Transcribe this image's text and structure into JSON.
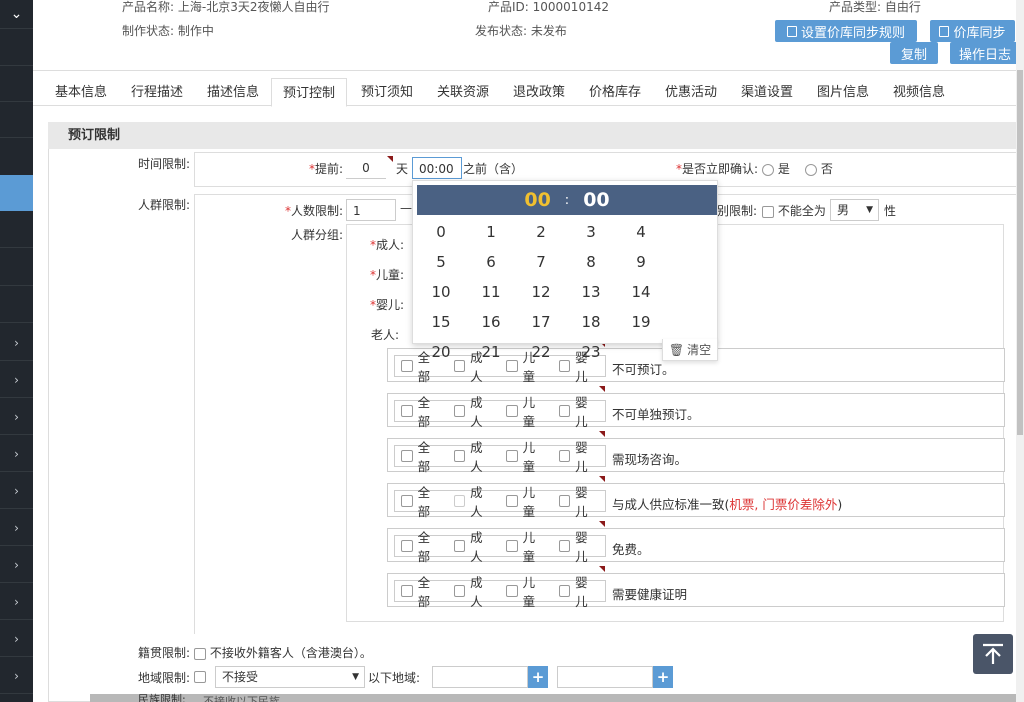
{
  "sidebar": {
    "toggle_icon": "chevron-down-icon",
    "item_icon": "chevron-right-icon"
  },
  "header": {
    "product_name": "产品名称: 上海-北京3天2夜懒人自由行",
    "product_id": "产品ID: 1000010142",
    "product_type": "产品类型: 自由行",
    "make_status": "制作状态: 制作中",
    "publish_status": "发布状态: 未发布",
    "btn_sync_rule": "设置价库同步规则",
    "btn_sync": "价库同步",
    "btn_copy": "复制",
    "btn_log": "操作日志"
  },
  "tabs": [
    "基本信息",
    "行程描述",
    "描述信息",
    "预订控制",
    "预订须知",
    "关联资源",
    "退改政策",
    "价格库存",
    "优惠活动",
    "渠道设置",
    "图片信息",
    "视频信息"
  ],
  "active_tab": "预订控制",
  "section": {
    "title": "预订限制"
  },
  "time_limit": {
    "label": "时间限制:",
    "advance_label": "提前:",
    "advance_days": "0",
    "day_unit": "天",
    "time_value": "00:00",
    "before_text": "之前（含）",
    "confirm_label": "是否立即确认:",
    "opt_yes": "是",
    "opt_no": "否"
  },
  "crowd": {
    "label": "人群限制:",
    "count_label": "人数限制:",
    "count_min": "1",
    "dash": "—",
    "gender_label_tail": "别限制:",
    "not_all": "不能全为",
    "gender_value": "男",
    "gender_tail": "性",
    "group_label": "人群分组:",
    "adult": "成人:",
    "child": "儿童:",
    "infant": "婴儿:",
    "elder": "老人:"
  },
  "rule_opts": [
    "全部",
    "成人",
    "儿童",
    "婴儿"
  ],
  "rules": [
    {
      "text": "不可预订。",
      "red": ""
    },
    {
      "text": "不可单独预订。",
      "red": ""
    },
    {
      "text": "需现场咨询。",
      "red": ""
    },
    {
      "text": "与成人供应标准一致(",
      "red": "机票, 门票价差除外",
      "tail": ")"
    },
    {
      "text": "免费。",
      "red": ""
    },
    {
      "text": "需要健康证明",
      "red": ""
    }
  ],
  "picker": {
    "hour": "00",
    "colon": ":",
    "minute": "00",
    "hours": [
      "0",
      "1",
      "2",
      "3",
      "4",
      "5",
      "6",
      "7",
      "8",
      "9",
      "10",
      "11",
      "12",
      "13",
      "14",
      "15",
      "16",
      "17",
      "18",
      "19",
      "20",
      "21",
      "22",
      "23"
    ],
    "clear": "清空",
    "clear_icon": "trash-icon"
  },
  "native": {
    "label": "籍贯限制:",
    "text": "不接收外籍客人（含港澳台）。"
  },
  "region": {
    "label": "地域限制:",
    "select": "不接受",
    "following": "以下地域:"
  },
  "ethnic": {
    "label": "民族限制:",
    "text": "不接收以下民族"
  },
  "colors": {
    "accent": "#5b9bd5",
    "sidebar": "#22272e",
    "picker_header": "#4a6183",
    "picker_hour": "#f0c030",
    "red_text": "#d33"
  }
}
